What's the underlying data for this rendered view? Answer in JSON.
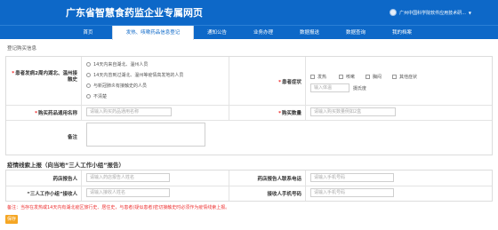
{
  "header": {
    "title": "广东省智慧食药监企业专属网页",
    "user_name": "广州中国科学院软件应用技术研..."
  },
  "nav": {
    "items": [
      {
        "label": "首页",
        "active": false
      },
      {
        "label": "发热、咳嗽药品信息登记",
        "active": true
      },
      {
        "label": "通知公告",
        "active": false
      },
      {
        "label": "业务办理",
        "active": false
      },
      {
        "label": "数据报送",
        "active": false
      },
      {
        "label": "数据查询",
        "active": false
      },
      {
        "label": "我的档案",
        "active": false
      }
    ]
  },
  "form": {
    "section_label": "登记购买信息",
    "travel": {
      "label": "患者发病2周内湖北、温州接触史",
      "options": [
        "14天内来自湖北、温州人员",
        "14天内曾到过湖北、温州等疫情高发地的人员",
        "与新冠肺炎有接触史的人员",
        "不清楚"
      ]
    },
    "symptom": {
      "label": "患者症状",
      "options": [
        "发热",
        "咳嗽",
        "胸闷",
        "其他症状"
      ],
      "temperature_placeholder": "输入体温",
      "temperature_unit": "摄氏度"
    },
    "drug_name": {
      "label": "购买药品通用名称",
      "placeholder": "请输入购买药品通用名称"
    },
    "quantity": {
      "label": "购买数量",
      "placeholder": "请输入购买数量例如2盒"
    },
    "remarks": {
      "label": "备注"
    }
  },
  "epidemic": {
    "title": "疫情线索上报（向当地“三人工作小组”报告）",
    "pharmacy_reporter": {
      "label": "药店报告人",
      "placeholder": "请输入药店报告人姓名"
    },
    "pharmacy_phone": {
      "label": "药店报告人联系电话",
      "placeholder": "请输入手机号码"
    },
    "group_receiver": {
      "label": "“三人工作小组”接收人",
      "placeholder": "请输入接收人姓名"
    },
    "receiver_phone": {
      "label": "接收人手机号码",
      "placeholder": "请输入手机号码"
    }
  },
  "note": "备注：当存在发热或14天内有湖北疫区旅行史、居住史，与患者(疑似患者)密切接触史时必须作为疫情线索上报。",
  "submit_label": "保存"
}
